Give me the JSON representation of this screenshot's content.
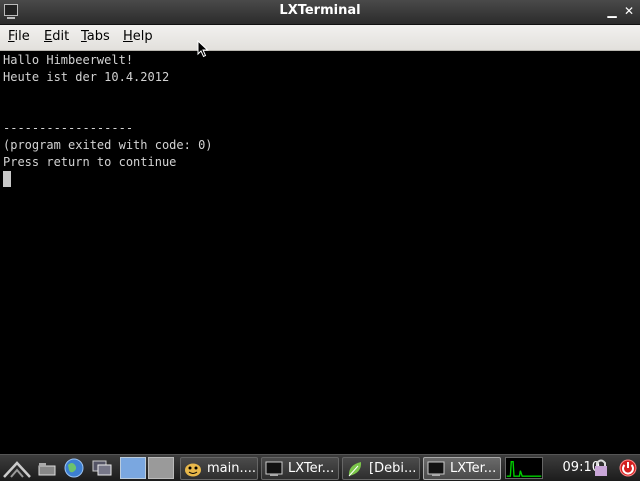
{
  "window": {
    "title": "LXTerminal"
  },
  "menu": [
    {
      "label": "File",
      "mnemonic": "F",
      "rest": "ile"
    },
    {
      "label": "Edit",
      "mnemonic": "E",
      "rest": "dit"
    },
    {
      "label": "Tabs",
      "mnemonic": "T",
      "rest": "abs"
    },
    {
      "label": "Help",
      "mnemonic": "H",
      "rest": "elp"
    }
  ],
  "terminal": {
    "lines": [
      "Hallo Himbeerwelt!",
      "Heute ist der 10.4.2012",
      "",
      "",
      "------------------",
      "(program exited with code: 0)",
      "Press return to continue"
    ]
  },
  "taskbar": {
    "tasks": [
      {
        "label": "main....",
        "icon": "geany-icon"
      },
      {
        "label": "LXTer...",
        "icon": "terminal-icon"
      },
      {
        "label": "[Debi...",
        "icon": "midori-browser-icon"
      },
      {
        "label": "LXTer...",
        "icon": "terminal-icon",
        "active": true
      }
    ],
    "clock": "09:10"
  },
  "colors": {
    "terminal_bg": "#000000",
    "terminal_fg": "#d3d3d3",
    "cpu_graph": "#00d000"
  }
}
